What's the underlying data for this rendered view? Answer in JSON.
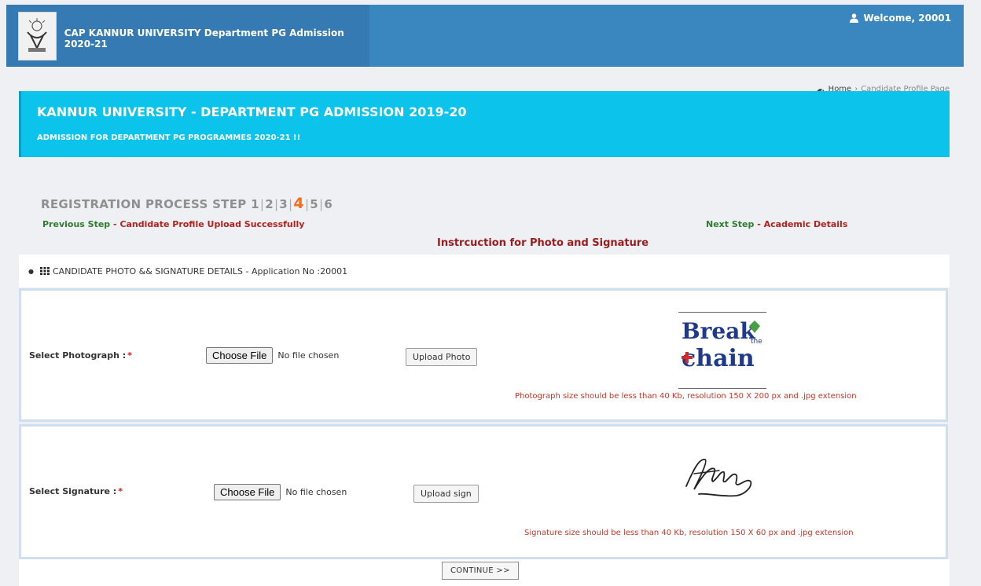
{
  "header": {
    "title": "CAP KANNUR UNIVERSITY Department PG Admission 2020-21",
    "welcome": "Welcome, 20001",
    "colors": {
      "bar": "#3a87c0",
      "brand_panel": "#357ab3"
    }
  },
  "breadcrumb": {
    "home": "Home",
    "separator": "›",
    "current": "Candidate Profile Page"
  },
  "hero": {
    "title": "KANNUR UNIVERSITY - DEPARTMENT PG ADMISSION 2019-20",
    "subtitle": "ADMISSION FOR DEPARTMENT PG PROGRAMMES 2020-21 !!",
    "color": "#0bc3eb"
  },
  "steps": {
    "label": "REGISTRATION PROCESS STEP",
    "items": [
      "1",
      "2",
      "3",
      "4",
      "5",
      "6"
    ],
    "current": "4",
    "separator": "|"
  },
  "navigation": {
    "previous_label": "Previous Step",
    "previous_value": "Candidate Profile Upload Successfully",
    "next_label": "Next Step",
    "next_value": "Academic Details",
    "dash": "-"
  },
  "instruction_link": "Instrcuction for Photo and Signature",
  "section": {
    "title": "CANDIDATE PHOTO && SIGNATURE DETAILS - Application No :20001"
  },
  "photo": {
    "label": "Select Photograph  :",
    "required_mark": "*",
    "choose_button": "Choose File",
    "file_status": "No file chosen",
    "upload_button": "Upload Photo",
    "note": "Photograph size should be less than 40 Kb, resolution 150 X 200 px and .jpg extension",
    "preview_text_top": "Break",
    "preview_text_small": "the",
    "preview_text_bottom": "chain"
  },
  "signature": {
    "label": "Select Signature  :",
    "required_mark": "*",
    "choose_button": "Choose File",
    "file_status": "No file chosen",
    "upload_button": "Upload sign",
    "note": "Signature size should be less than 40 Kb, resolution 150 X 60 px and .jpg extension"
  },
  "continue_button": "CONTINUE >>"
}
